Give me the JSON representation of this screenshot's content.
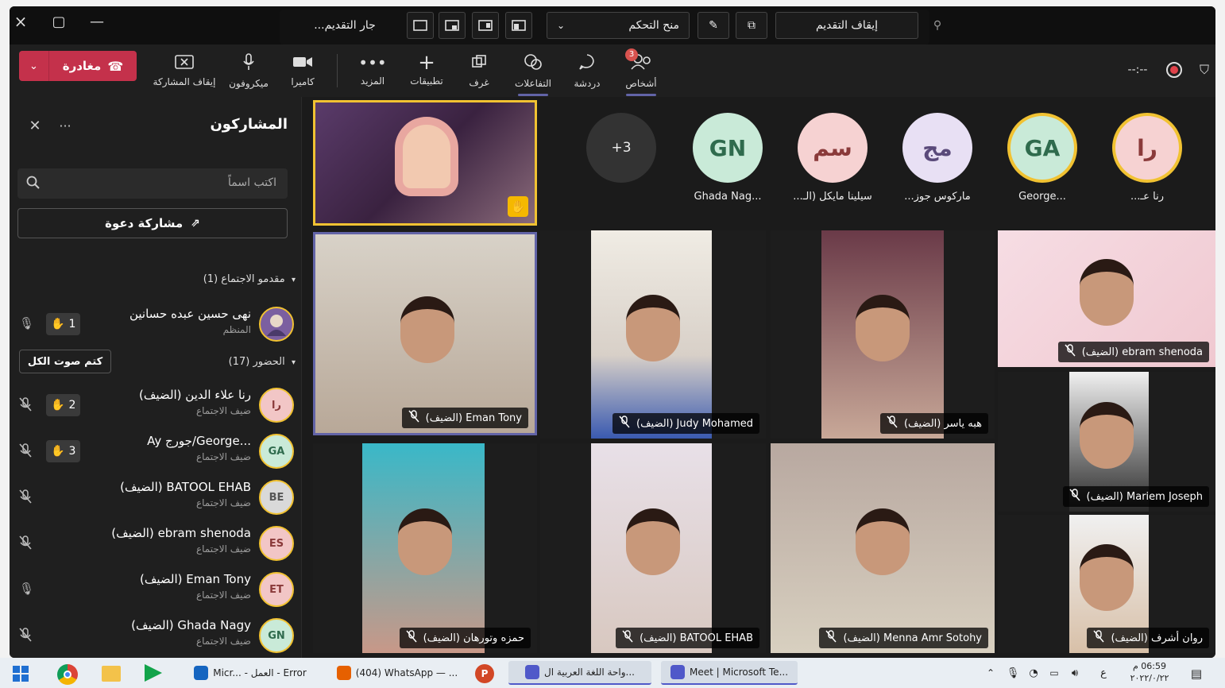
{
  "titlebar": {
    "window_controls": [
      "×",
      "▢",
      "—"
    ],
    "presenting_label": "...جار التقديم",
    "give_control_label": "منح التحكم",
    "stop_presenting_label": "إيقاف التقديم"
  },
  "toolbar": {
    "leave_label": "مغادرة",
    "stop_share_label": "إيقاف المشاركة",
    "mic_label": "ميكروفون",
    "camera_label": "كاميرا",
    "more_label": "المزيد",
    "apps_label": "تطبيقات",
    "rooms_label": "غرف",
    "reactions_label": "التفاعلات",
    "chat_label": "دردشة",
    "people_label": "أشخاص",
    "people_badge": "3",
    "timer": "--:--"
  },
  "panel": {
    "title": "المشاركون",
    "more": "···",
    "close": "✕",
    "search_placeholder": "اكتب اسماً",
    "invite_label": "مشاركة دعوة",
    "presenters_header": "مقدمو الاجتماع (1)",
    "attendees_header": "الحضور (17)",
    "mute_all_label": "كتم صوت الكل",
    "presenter": {
      "name": "نهى حسين عبده حسانين",
      "role": "المنظم",
      "hand": "1"
    },
    "attendees": [
      {
        "initials": "را",
        "name": "رنا علاء الدين (الضيف)",
        "role": "ضيف الاجتماع",
        "hand": "2",
        "color": "#f2c6c6",
        "text_color": "#8a3a3a"
      },
      {
        "initials": "GA",
        "name": "...George/جورج Ay",
        "role": "ضيف الاجتماع",
        "hand": "3",
        "color": "#c9ead8",
        "text_color": "#2f6b4d"
      },
      {
        "initials": "BE",
        "name": "BATOOL EHAB (الضيف)",
        "role": "ضيف الاجتماع",
        "hand": "",
        "color": "#d9d9d9",
        "text_color": "#555555"
      },
      {
        "initials": "ES",
        "name": "ebram shenoda (الضيف)",
        "role": "ضيف الاجتماع",
        "hand": "",
        "color": "#f2c6c6",
        "text_color": "#8a3a3a"
      },
      {
        "initials": "ET",
        "name": "Eman Tony (الضيف)",
        "role": "ضيف الاجتماع",
        "hand": "",
        "color": "#f2c6c6",
        "text_color": "#8a3a3a"
      },
      {
        "initials": "GN",
        "name": "Ghada Nagy (الضيف)",
        "role": "ضيف الاجتماع",
        "hand": "",
        "color": "#c9ead8",
        "text_color": "#2f6b4d"
      }
    ]
  },
  "stage": {
    "overflow": "+3",
    "bubbles": [
      {
        "initials": "GN",
        "label": "...Ghada Nag",
        "color": "#c9ead8",
        "text_color": "#2f6b4d"
      },
      {
        "initials": "سم",
        "label": "سيلينا مايكل (الـ...",
        "color": "#f6d2d2",
        "text_color": "#8a3a3a"
      },
      {
        "initials": "مج",
        "label": "ماركوس جوز...",
        "color": "#e8e0f4",
        "text_color": "#5a4a7a"
      },
      {
        "initials": "GA",
        "label": "...George",
        "color": "#c9ead8",
        "text_color": "#2f6b4d"
      },
      {
        "initials": "را",
        "label": "رنا عـ...",
        "color": "#f6d2d2",
        "text_color": "#8a3a3a"
      }
    ],
    "tiles": [
      "Eman Tony (الضيف)",
      "Judy Mohamed (الضيف)",
      "هبه ياسر (الضيف)",
      "ebram shenoda (الضيف)",
      "Mariem Joseph (الضيف)",
      "حمزه وتورهان (الضيف)",
      "BATOOL EHAB (الضيف)",
      "Menna Amr Sotohy (الضيف)",
      "روان أشرف (الضيف)"
    ]
  },
  "taskbar": {
    "apps": [
      "Micr... - العمل - Error",
      "(404) WhatsApp — ...",
      "واحة اللغة العربية ال...",
      "Meet | Microsoft Te..."
    ],
    "lang": "ع",
    "time": "06:59 م",
    "date": "٢٠٢٢/٠/٢٢"
  }
}
